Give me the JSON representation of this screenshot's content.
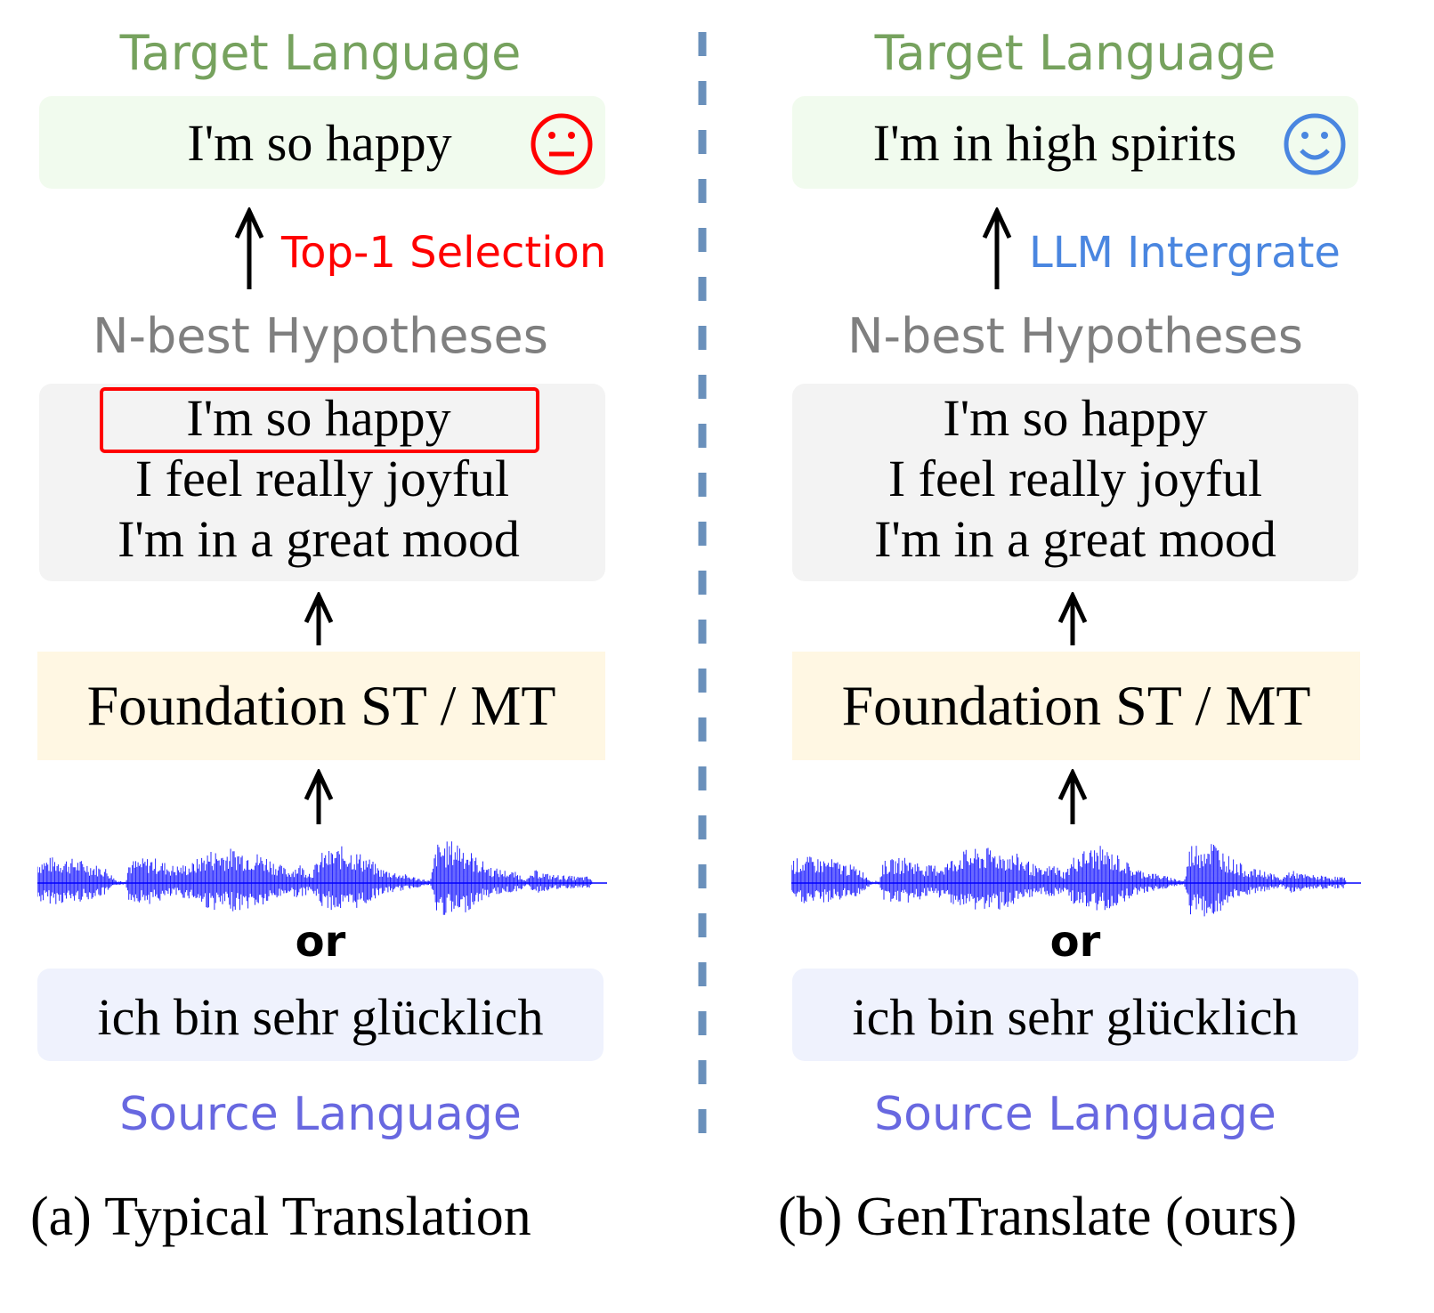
{
  "panels": [
    {
      "id": "typical",
      "target_label": "Target Language",
      "output_text": "I'm so happy",
      "output_icon": "neutral-face-icon",
      "output_icon_color": "#ff0000",
      "arrow_annotation": "Top-1 Selection",
      "arrow_annotation_color": "#ff0000",
      "nbest_label": "N-best Hypotheses",
      "hypotheses": [
        "I'm so happy",
        "I feel really joyful",
        "I'm in a great mood"
      ],
      "selected_hypothesis_index": 0,
      "model_label": "Foundation ST / MT",
      "or_label": "or",
      "source_text": "ich bin sehr glücklich",
      "source_label": "Source Language",
      "caption": "(a) Typical Translation"
    },
    {
      "id": "gentranslate",
      "target_label": "Target Language",
      "output_text": "I'm in high spirits",
      "output_icon": "smiling-face-icon",
      "output_icon_color": "#4a86e0",
      "arrow_annotation": "LLM Intergrate",
      "arrow_annotation_color": "#4a86e0",
      "nbest_label": "N-best Hypotheses",
      "hypotheses": [
        "I'm so happy",
        "I feel really joyful",
        "I'm in a great mood"
      ],
      "selected_hypothesis_index": null,
      "model_label": "Foundation ST / MT",
      "or_label": "or",
      "source_text": "ich bin sehr glücklich",
      "source_label": "Source Language",
      "caption": "(b) GenTranslate (ours)"
    }
  ],
  "colors": {
    "target_label": "#76a25e",
    "nbest_label": "#7f7f7f",
    "source_label": "#6868e0",
    "waveform": "#0000ff",
    "divider": "#6a90bb"
  }
}
